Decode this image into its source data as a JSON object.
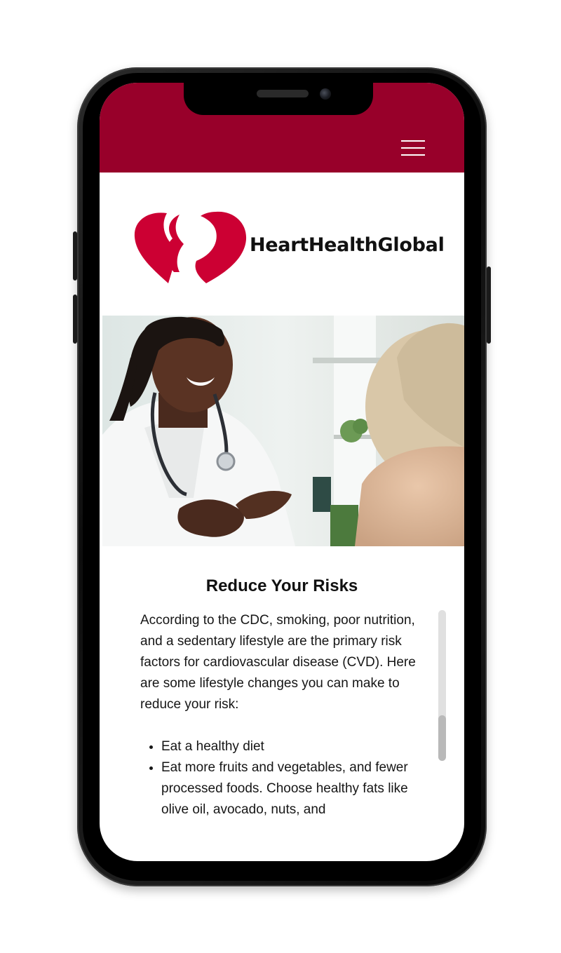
{
  "brand": {
    "name": "HeartHealthGlobal",
    "primary_color": "#98002a",
    "logo_color": "#cc0033"
  },
  "header": {
    "menu_icon": "hamburger-menu-icon"
  },
  "hero": {
    "image_description": "doctor-consulting-patient-photo"
  },
  "main": {
    "title": "Reduce Your Risks",
    "intro": "According to the CDC, smoking, poor nutrition, and a sedentary lifestyle are the primary risk factors for cardiovascular disease (CVD). Here are some lifestyle changes you can make to reduce your risk:",
    "list": [
      "Eat a healthy diet",
      "Eat more fruits and vegetables, and fewer processed foods. Choose healthy fats like olive oil, avocado, nuts, and"
    ]
  },
  "scrollbar": {
    "position_fraction": 0.7,
    "thumb_fraction": 0.3
  }
}
